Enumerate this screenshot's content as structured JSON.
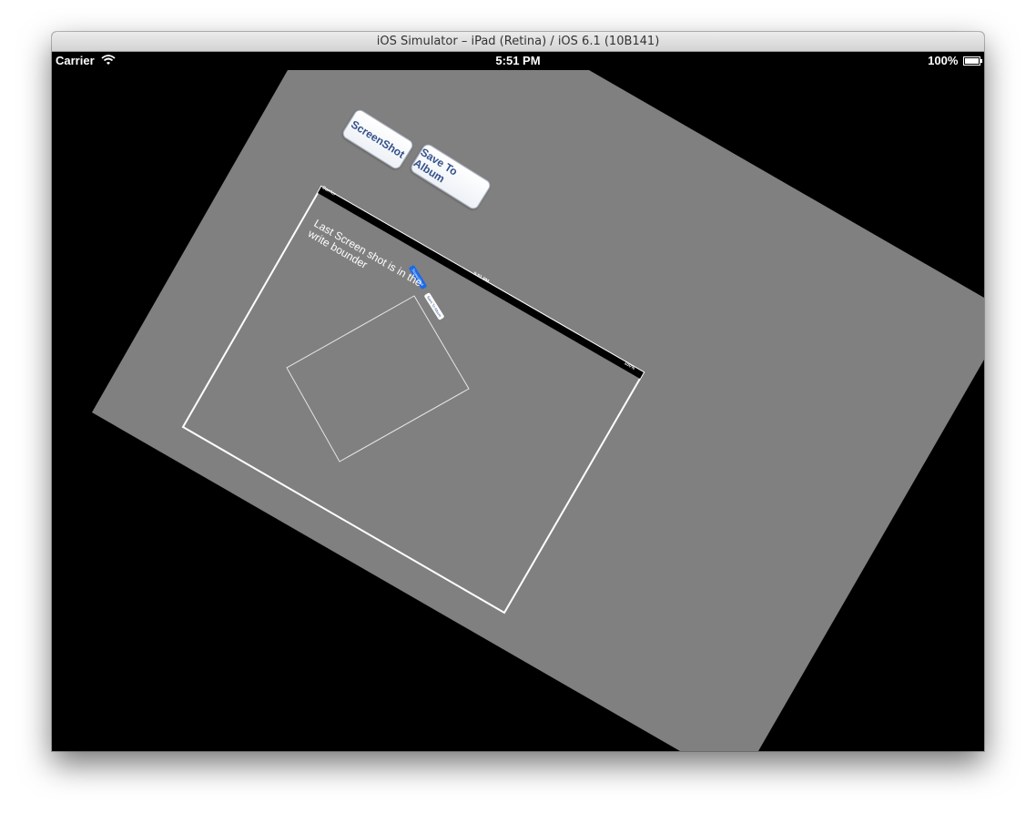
{
  "window": {
    "title": "iOS Simulator – iPad (Retina) / iOS 6.1 (10B141)"
  },
  "statusbar": {
    "carrier": "Carrier",
    "time": "5:51 PM",
    "battery": "100%"
  },
  "buttons": {
    "screenshot": "ScreenShot",
    "save": "Save To Album"
  },
  "caption": "Last Screen shot is in the write bounder",
  "nested_capture": {
    "carrier": "Carrier",
    "time": "5:51 PM",
    "battery": "100%",
    "screenshot_label": "ScreenShot",
    "save_label": "Save To Album"
  },
  "colors": {
    "screen_background": "#000000",
    "rotated_view": "#808080",
    "bounder": "#ffffff",
    "button_text": "#34528a",
    "selected_button": "#1d6ae8"
  }
}
